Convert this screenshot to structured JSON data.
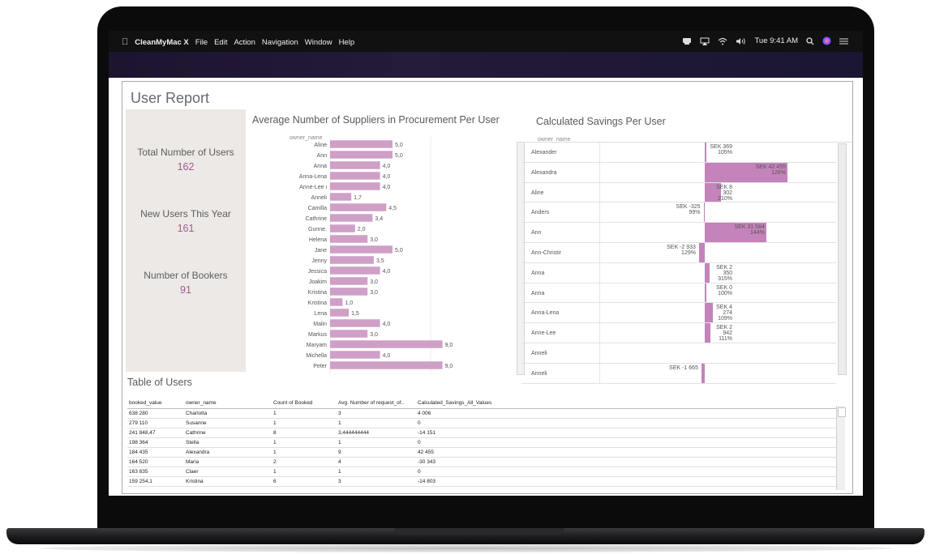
{
  "menubar": {
    "app": "CleanMyMac X",
    "items": [
      "File",
      "Edit",
      "Action",
      "Navigation",
      "Window",
      "Help"
    ],
    "clock": "Tue 9:41 AM"
  },
  "report": {
    "title": "User Report",
    "kpis": [
      {
        "label": "Total Number of Users",
        "value": "162"
      },
      {
        "label": "New Users This Year",
        "value": "161"
      },
      {
        "label": "Number of Bookers",
        "value": "91"
      }
    ]
  },
  "chart_data": [
    {
      "type": "bar",
      "title": "Average Number of Suppliers in Procurement Per User",
      "header": "owner_name",
      "categories": [
        "Aline",
        "Ann",
        "Anna",
        "Anna-Lena",
        "Anne-Lee ι",
        "Anneli",
        "Camilla",
        "Cathrine",
        "Gunne.",
        "Helena",
        "Jane",
        "Jenny",
        "Jessica",
        "Joakim",
        "Kristina",
        "Kristina",
        "Lena",
        "Malin",
        "Markus",
        "Maryam",
        "Michella",
        "Peter"
      ],
      "values": [
        5.0,
        5.0,
        4.0,
        4.0,
        4.0,
        1.7,
        4.5,
        3.4,
        2.0,
        3.0,
        5.0,
        3.5,
        4.0,
        3.0,
        3.0,
        1.0,
        1.5,
        4.0,
        3.0,
        9.0,
        4.0,
        9.0
      ],
      "labels": [
        "5,0",
        "5,0",
        "4,0",
        "4,0",
        "4,0",
        "1,7",
        "4,5",
        "3,4",
        "2,0",
        "3,0",
        "5,0",
        "3,5",
        "4,0",
        "3,0",
        "3,0",
        "1,0",
        "1,5",
        "4,0",
        "3,0",
        "9,0",
        "4,0",
        "9,0"
      ],
      "color": "#cf9fc7"
    },
    {
      "type": "bar",
      "title": "Calculated Savings Per User",
      "header": "owner_name",
      "categories": [
        "Alexander",
        "Alexandra",
        "Aline",
        "Anders",
        "Ann",
        "Ann-Christir",
        "Anna",
        "Anna",
        "Anna-Lena",
        "Anne-Lee",
        "Anneli",
        "Anneli"
      ],
      "values": [
        369,
        42455,
        8302,
        -325,
        31584,
        -2933,
        2350,
        0,
        4274,
        2942,
        null,
        -1665
      ],
      "value_labels": [
        "SEK 369",
        "SEK 42 455",
        "SEK 8 302",
        "SEK -325",
        "SEK 31 584",
        "SEK -2 933",
        "SEK 2 350",
        "SEK 0",
        "SEK 4 274",
        "SEK 2 942",
        "",
        "SEK -1 665"
      ],
      "pct_labels": [
        "105%",
        "126%",
        "210%",
        "99%",
        "144%",
        "129%",
        "315%",
        "100%",
        "109%",
        "111%",
        "",
        ""
      ],
      "color": "#c483bb"
    }
  ],
  "table": {
    "title": "Table of Users",
    "columns": [
      "booked_value",
      "owner_name",
      "Count of Booked",
      "Avg. Number of request_of..",
      "Calculated_Savings_All_Values"
    ],
    "rows": [
      [
        "638 280",
        "Charlotta",
        "1",
        "3",
        "4 006"
      ],
      [
        "279 110",
        "Susanne",
        "1",
        "1",
        "0"
      ],
      [
        "241 848,47",
        "Cathrine",
        "8",
        "3,444444444",
        "-14 151"
      ],
      [
        "198 364",
        "Stella",
        "1",
        "1",
        "0"
      ],
      [
        "184 435",
        "Alexandra",
        "1",
        "9",
        "42 455"
      ],
      [
        "164 520",
        "Maria",
        "2",
        "4",
        "-30 343"
      ],
      [
        "163 835",
        "Claer",
        "1",
        "1",
        "0"
      ],
      [
        "159 254,1",
        "Kristina",
        "6",
        "3",
        "-14 803"
      ]
    ]
  },
  "icons": [
    "apple-icon",
    "cleanmymac-menu-icon",
    "airplay-icon",
    "wifi-icon",
    "volume-icon",
    "search-icon",
    "siri-icon",
    "control-center-icon"
  ]
}
